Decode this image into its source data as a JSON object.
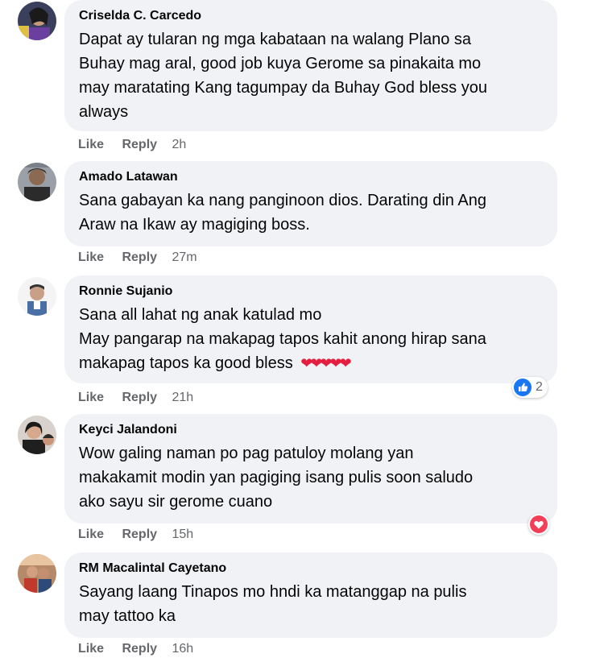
{
  "actions": {
    "like": "Like",
    "reply": "Reply"
  },
  "colors": {
    "bubble": "#f0f2f5",
    "meta": "#65676b",
    "like_blue": "#1877f2",
    "love_red": "#f33e58"
  },
  "comments": [
    {
      "author": "Criselda C. Carcedo",
      "lines": [
        "Dapat ay tularan ng mga kabataan na walang Plano sa",
        "Buhay mag aral, good job kuya Gerome sa pinakaita mo",
        "may maratating Kang tagumpay da Buhay God bless you",
        "always"
      ],
      "time": "2h"
    },
    {
      "author": "Amado Latawan",
      "lines": [
        "Sana gabayan ka nang panginoon dios. Darating din Ang",
        "Araw na Ikaw ay magiging boss."
      ],
      "time": "27m"
    },
    {
      "author": "Ronnie Sujanio",
      "lines": [
        "Sana all lahat ng anak katulad mo",
        "May pangarap na makapag tapos kahit anong hirap sana",
        "makapag tapos ka good bless"
      ],
      "hearts": "❤❤❤❤❤",
      "time": "21h",
      "reaction": {
        "icon": "like-icon",
        "count": "2"
      }
    },
    {
      "author": "Keyci Jalandoni",
      "lines": [
        "Wow galing naman po pag patuloy molang yan",
        "makakamit modin yan pagiging isang pulis soon saludo",
        "ako sayu sir gerome cuano"
      ],
      "time": "15h",
      "reaction": {
        "icon": "love-icon"
      }
    },
    {
      "author": "RM Macalintal Cayetano",
      "lines": [
        "Sayang laang Tinapos mo hndi ka matanggap na pulis",
        "may tattoo ka"
      ],
      "time": "16h"
    }
  ]
}
